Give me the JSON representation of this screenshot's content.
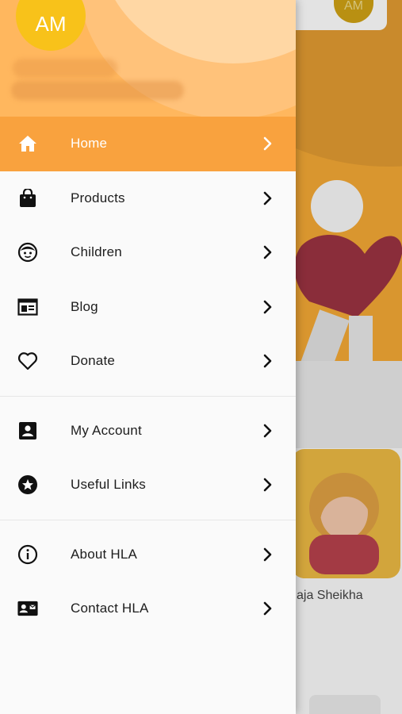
{
  "background": {
    "avatar_initials": "AM",
    "card_name": "aja Sheikha"
  },
  "drawer": {
    "header": {
      "avatar_initials": "AM"
    },
    "menu": {
      "group1": [
        {
          "label": "Home",
          "icon": "home-icon",
          "active": true
        },
        {
          "label": "Products",
          "icon": "shopping-bag-icon",
          "active": false
        },
        {
          "label": "Children",
          "icon": "child-face-icon",
          "active": false
        },
        {
          "label": "Blog",
          "icon": "newspaper-icon",
          "active": false
        },
        {
          "label": "Donate",
          "icon": "heart-icon",
          "active": false
        }
      ],
      "group2": [
        {
          "label": "My Account",
          "icon": "account-box-icon"
        },
        {
          "label": "Useful Links",
          "icon": "star-circle-icon"
        }
      ],
      "group3": [
        {
          "label": "About HLA",
          "icon": "info-icon"
        },
        {
          "label": "Contact HLA",
          "icon": "contact-card-icon"
        }
      ]
    }
  },
  "colors": {
    "accent": "#f9a23e",
    "header": "#ffb75e",
    "avatar": "#f8c21a"
  }
}
